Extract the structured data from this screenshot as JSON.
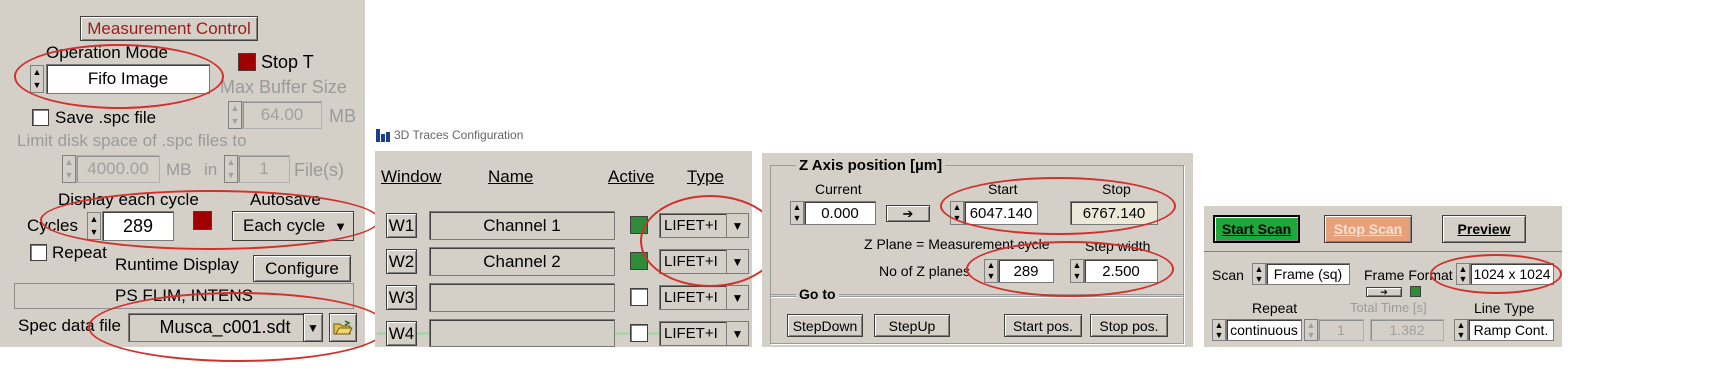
{
  "panel1": {
    "title": "Measurement Control",
    "operation_mode_label": "Operation Mode",
    "operation_mode_value": "Fifo Image",
    "stop_t_label": "Stop T",
    "max_buffer_label": "Max Buffer Size",
    "max_buffer_value": "64.00",
    "max_buffer_unit": "MB",
    "save_spc_label": "Save .spc file",
    "limit_disk_label": "Limit disk space of .spc files to",
    "limit_disk_value": "4000.00",
    "limit_disk_unit": "MB",
    "in_label": "in",
    "files_value": "1",
    "files_unit": "File(s)",
    "display_each_cycle_label": "Display each cycle",
    "autosave_label": "Autosave",
    "cycles_label": "Cycles",
    "cycles_value": "289",
    "autosave_value": "Each cycle",
    "repeat_label": "Repeat",
    "runtime_display_label": "Runtime Display",
    "configure_label": "Configure",
    "status_value": "PS FLIM, INTENS",
    "spec_data_label": "Spec data file",
    "spec_data_value": "Musca_c001.sdt"
  },
  "panel2": {
    "window_title": "3D Traces Configuration",
    "headers": [
      "Window",
      "Name",
      "Active",
      "Type"
    ],
    "rows": [
      {
        "window": "W1",
        "name": "Channel 1",
        "active": true,
        "type": "LIFET+I"
      },
      {
        "window": "W2",
        "name": "Channel 2",
        "active": true,
        "type": "LIFET+I"
      },
      {
        "window": "W3",
        "name": "",
        "active": false,
        "type": "LIFET+I"
      },
      {
        "window": "W4",
        "name": "",
        "active": false,
        "type": "LIFET+I"
      }
    ],
    "colors": {
      "active_led": "#2e8b3a"
    }
  },
  "panel3": {
    "group_title": "Z  Axis position [µm]",
    "current_label": "Current",
    "current_value": "0.000",
    "start_label": "Start",
    "start_value": "6047.140",
    "stop_label": "Stop",
    "stop_value": "6767.140",
    "zplane_label": "Z Plane = Measurement cycle",
    "step_width_label": "Step width",
    "no_z_planes_label": "No of  Z planes",
    "no_z_planes_value": "289",
    "step_width_value": "2.500",
    "goto_title": "Go to",
    "stepdown_label": "StepDown",
    "stepup_label": "StepUp",
    "start_pos_label": "Start pos.",
    "stop_pos_label": "Stop pos."
  },
  "panel4": {
    "start_scan_label": "Start Scan",
    "stop_scan_label": "Stop Scan",
    "preview_label": "Preview",
    "scan_label": "Scan",
    "scan_value": "Frame (sq)",
    "frame_format_label": "Frame Format",
    "frame_format_value": "1024 x 1024",
    "repeat_label": "Repeat",
    "repeat_value": "continuous",
    "repeat_count_value": "1",
    "total_time_label": "Total Time [s]",
    "total_time_value": "1.382",
    "line_type_label": "Line Type",
    "line_type_value": "Ramp Cont.",
    "colors": {
      "start_scan_bg": "#1fa73a",
      "stop_scan_bg": "#e8a07a"
    }
  },
  "colors": {
    "highlight_oval": "#d2302c",
    "panel_bg": "#d4d0c8",
    "stop_led": "#a00000"
  }
}
